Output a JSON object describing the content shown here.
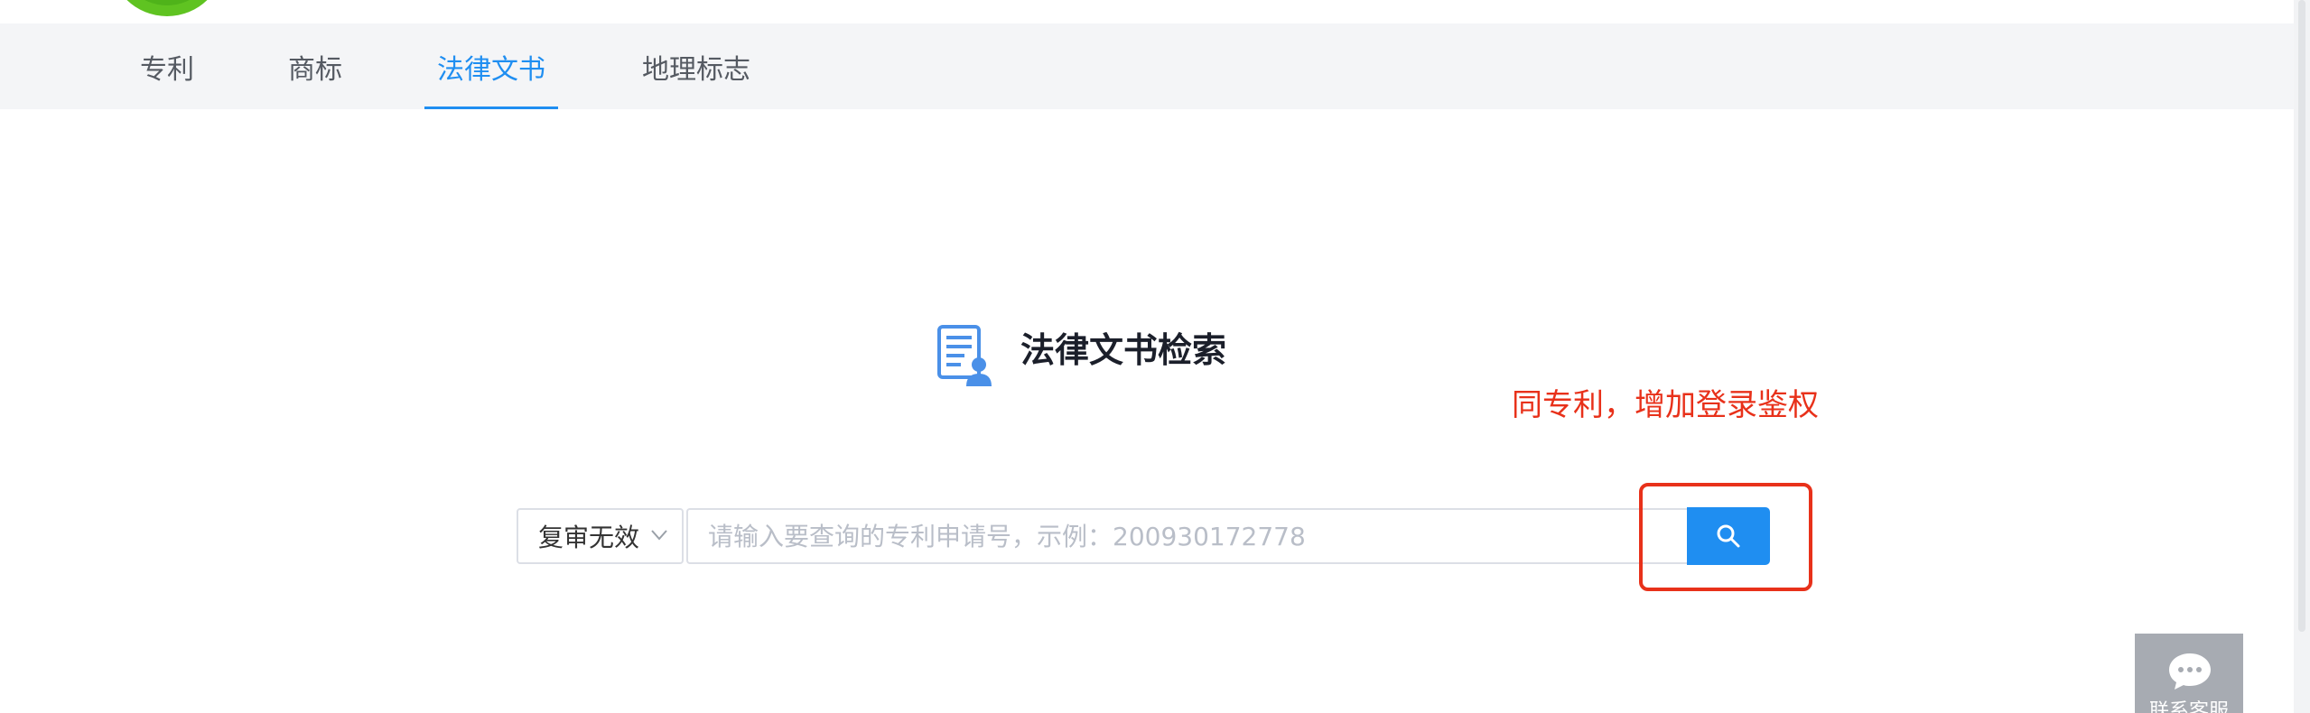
{
  "tabs": [
    {
      "label": "专利"
    },
    {
      "label": "商标"
    },
    {
      "label": "法律文书"
    },
    {
      "label": "地理标志"
    }
  ],
  "active_tab": "法律文书",
  "title": "法律文书检索",
  "annotation": "同专利，增加登录鉴权",
  "search": {
    "type_selected": "复审无效",
    "placeholder": "请输入要查询的专利申请号，示例：200930172778",
    "value": ""
  },
  "float_widget": {
    "label": "联系客服"
  },
  "icons": {
    "title": "legal-document-icon",
    "search": "search-icon",
    "dropdown": "chevron-down-icon",
    "chat": "chat-bubble-icon"
  },
  "colors": {
    "accent": "#1f8ef1",
    "annotation": "#e8311a",
    "tabbar_bg": "#f4f5f7",
    "logo_green": "#5fc321"
  }
}
